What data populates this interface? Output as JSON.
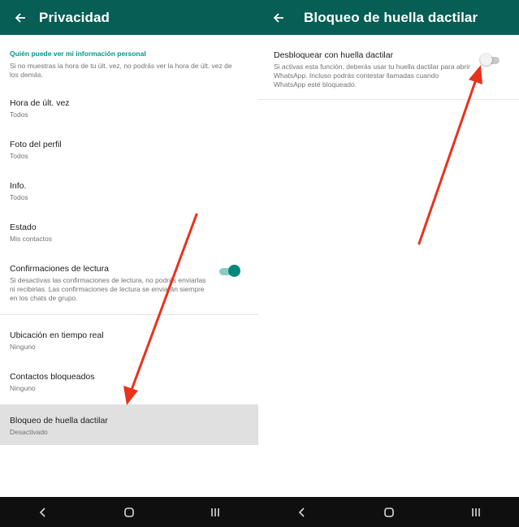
{
  "left_screen": {
    "title": "Privacidad",
    "section_header": "Quién puede ver mi información personal",
    "section_desc": "Si no muestras la hora de tu últ. vez, no podrás ver la hora de últ. vez de los demás.",
    "items": [
      {
        "title": "Hora de últ. vez",
        "sub": "Todos"
      },
      {
        "title": "Foto del perfil",
        "sub": "Todos"
      },
      {
        "title": "Info.",
        "sub": "Todos"
      },
      {
        "title": "Estado",
        "sub": "Mis contactos"
      },
      {
        "title": "Confirmaciones de lectura",
        "sub": "Si desactivas las confirmaciones de lectura, no podrás enviarlas ni recibirlas. Las confirmaciones de lectura se enviarán siempre en los chats de grupo.",
        "toggle": "on"
      },
      {
        "title": "Ubicación en tiempo real",
        "sub": "Ninguno"
      },
      {
        "title": "Contactos bloqueados",
        "sub": "Ninguno"
      },
      {
        "title": "Bloqueo de huella dactilar",
        "sub": "Desactivado",
        "highlighted": true
      }
    ]
  },
  "right_screen": {
    "title": "Bloqueo de huella dactilar",
    "setting": {
      "title": "Desbloquear con huella dactilar",
      "desc": "Si activas esta función, deberás usar tu huella dactilar para abrir WhatsApp. Incluso podrás contestar llamadas cuando WhatsApp esté bloqueado.",
      "toggle": "off"
    }
  },
  "colors": {
    "app_bar": "#075e54",
    "accent": "#009688",
    "toggle_on": "#00897b",
    "highlight_row": "#e0e0e0",
    "annotation_arrow": "#e8321e",
    "nav_bar": "#0f0f0f"
  },
  "nav_bar": {
    "buttons": [
      "back-icon",
      "home-icon",
      "recents-icon"
    ]
  }
}
